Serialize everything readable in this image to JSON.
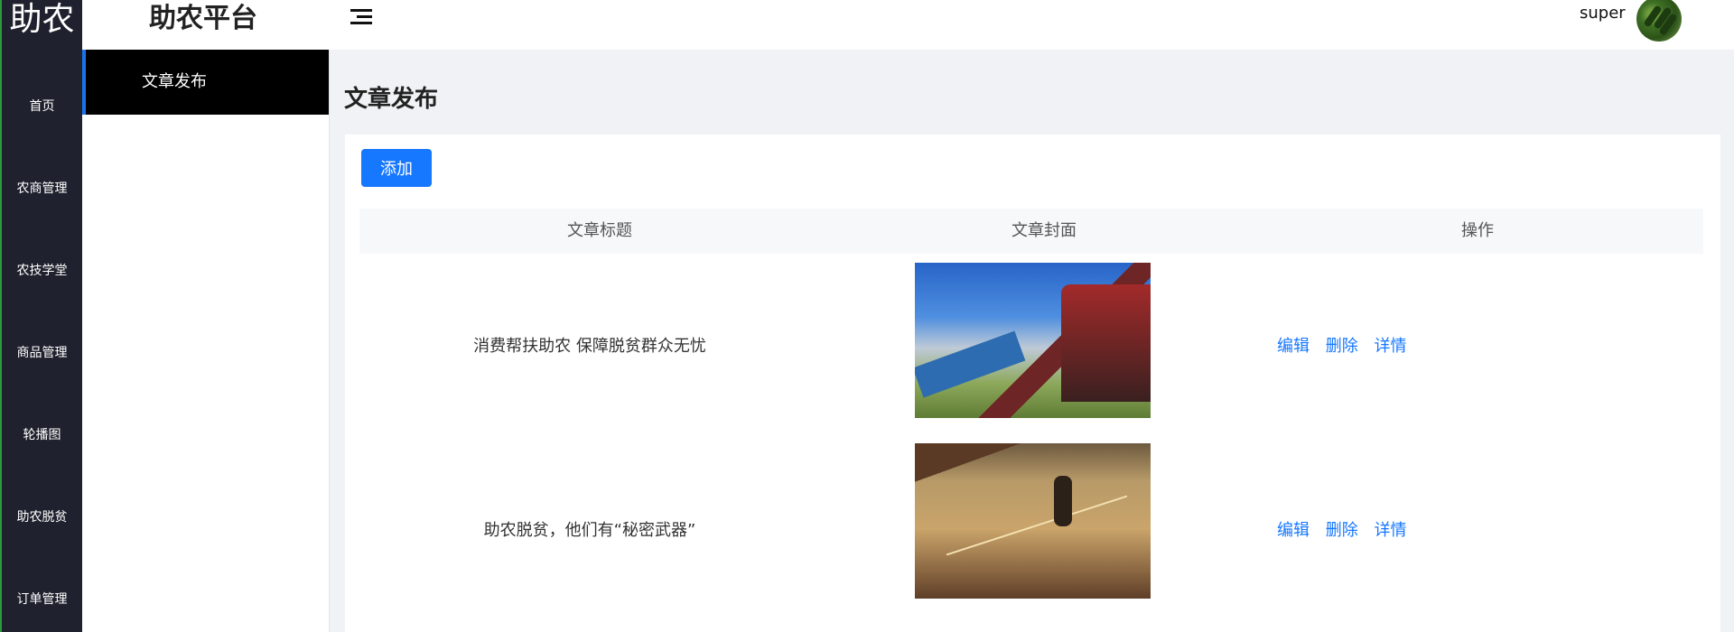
{
  "app": {
    "logo_text": "助农",
    "brand": "助农平台"
  },
  "rail_items": [
    "首页",
    "农商管理",
    "农技学堂",
    "商品管理",
    "轮播图",
    "助农脱贫",
    "订单管理"
  ],
  "subnav": {
    "active_item": "文章发布"
  },
  "header": {
    "username": "super"
  },
  "page": {
    "title": "文章发布",
    "add_button": "添加",
    "table": {
      "columns": [
        "文章标题",
        "文章封面",
        "操作"
      ],
      "rows": [
        {
          "title": "消费帮扶助农 保障脱贫群众无忧",
          "cover": "harvest-machine-photo",
          "actions": [
            "编辑",
            "删除",
            "详情"
          ]
        },
        {
          "title": "助农脱贫，他们有“秘密武器”",
          "cover": "grain-drying-photo",
          "actions": [
            "编辑",
            "删除",
            "详情"
          ]
        }
      ]
    }
  },
  "colors": {
    "primary": "#1677ff",
    "rail_background": "#1f222e",
    "active_subnav": "#000000"
  }
}
